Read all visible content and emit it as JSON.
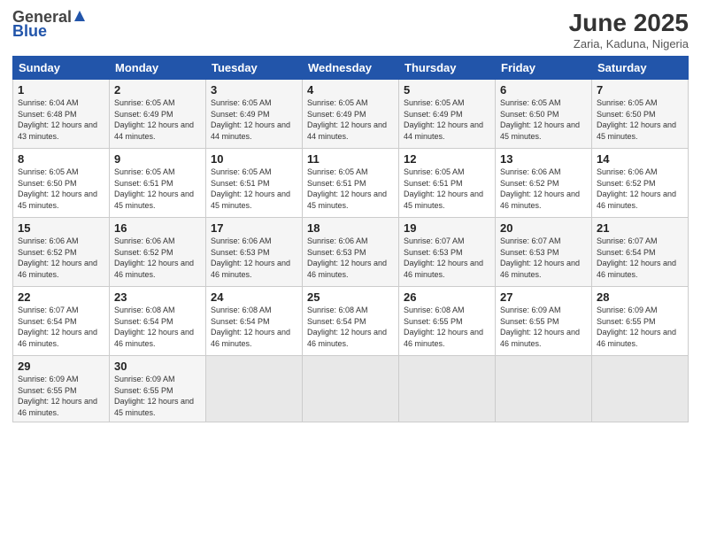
{
  "header": {
    "logo_general": "General",
    "logo_blue": "Blue",
    "title": "June 2025",
    "subtitle": "Zaria, Kaduna, Nigeria"
  },
  "weekdays": [
    "Sunday",
    "Monday",
    "Tuesday",
    "Wednesday",
    "Thursday",
    "Friday",
    "Saturday"
  ],
  "weeks": [
    [
      {
        "day": "1",
        "sunrise": "6:04 AM",
        "sunset": "6:48 PM",
        "daylight": "12 hours and 43 minutes."
      },
      {
        "day": "2",
        "sunrise": "6:05 AM",
        "sunset": "6:49 PM",
        "daylight": "12 hours and 44 minutes."
      },
      {
        "day": "3",
        "sunrise": "6:05 AM",
        "sunset": "6:49 PM",
        "daylight": "12 hours and 44 minutes."
      },
      {
        "day": "4",
        "sunrise": "6:05 AM",
        "sunset": "6:49 PM",
        "daylight": "12 hours and 44 minutes."
      },
      {
        "day": "5",
        "sunrise": "6:05 AM",
        "sunset": "6:49 PM",
        "daylight": "12 hours and 44 minutes."
      },
      {
        "day": "6",
        "sunrise": "6:05 AM",
        "sunset": "6:50 PM",
        "daylight": "12 hours and 45 minutes."
      },
      {
        "day": "7",
        "sunrise": "6:05 AM",
        "sunset": "6:50 PM",
        "daylight": "12 hours and 45 minutes."
      }
    ],
    [
      {
        "day": "8",
        "sunrise": "6:05 AM",
        "sunset": "6:50 PM",
        "daylight": "12 hours and 45 minutes."
      },
      {
        "day": "9",
        "sunrise": "6:05 AM",
        "sunset": "6:51 PM",
        "daylight": "12 hours and 45 minutes."
      },
      {
        "day": "10",
        "sunrise": "6:05 AM",
        "sunset": "6:51 PM",
        "daylight": "12 hours and 45 minutes."
      },
      {
        "day": "11",
        "sunrise": "6:05 AM",
        "sunset": "6:51 PM",
        "daylight": "12 hours and 45 minutes."
      },
      {
        "day": "12",
        "sunrise": "6:05 AM",
        "sunset": "6:51 PM",
        "daylight": "12 hours and 45 minutes."
      },
      {
        "day": "13",
        "sunrise": "6:06 AM",
        "sunset": "6:52 PM",
        "daylight": "12 hours and 46 minutes."
      },
      {
        "day": "14",
        "sunrise": "6:06 AM",
        "sunset": "6:52 PM",
        "daylight": "12 hours and 46 minutes."
      }
    ],
    [
      {
        "day": "15",
        "sunrise": "6:06 AM",
        "sunset": "6:52 PM",
        "daylight": "12 hours and 46 minutes."
      },
      {
        "day": "16",
        "sunrise": "6:06 AM",
        "sunset": "6:52 PM",
        "daylight": "12 hours and 46 minutes."
      },
      {
        "day": "17",
        "sunrise": "6:06 AM",
        "sunset": "6:53 PM",
        "daylight": "12 hours and 46 minutes."
      },
      {
        "day": "18",
        "sunrise": "6:06 AM",
        "sunset": "6:53 PM",
        "daylight": "12 hours and 46 minutes."
      },
      {
        "day": "19",
        "sunrise": "6:07 AM",
        "sunset": "6:53 PM",
        "daylight": "12 hours and 46 minutes."
      },
      {
        "day": "20",
        "sunrise": "6:07 AM",
        "sunset": "6:53 PM",
        "daylight": "12 hours and 46 minutes."
      },
      {
        "day": "21",
        "sunrise": "6:07 AM",
        "sunset": "6:54 PM",
        "daylight": "12 hours and 46 minutes."
      }
    ],
    [
      {
        "day": "22",
        "sunrise": "6:07 AM",
        "sunset": "6:54 PM",
        "daylight": "12 hours and 46 minutes."
      },
      {
        "day": "23",
        "sunrise": "6:08 AM",
        "sunset": "6:54 PM",
        "daylight": "12 hours and 46 minutes."
      },
      {
        "day": "24",
        "sunrise": "6:08 AM",
        "sunset": "6:54 PM",
        "daylight": "12 hours and 46 minutes."
      },
      {
        "day": "25",
        "sunrise": "6:08 AM",
        "sunset": "6:54 PM",
        "daylight": "12 hours and 46 minutes."
      },
      {
        "day": "26",
        "sunrise": "6:08 AM",
        "sunset": "6:55 PM",
        "daylight": "12 hours and 46 minutes."
      },
      {
        "day": "27",
        "sunrise": "6:09 AM",
        "sunset": "6:55 PM",
        "daylight": "12 hours and 46 minutes."
      },
      {
        "day": "28",
        "sunrise": "6:09 AM",
        "sunset": "6:55 PM",
        "daylight": "12 hours and 46 minutes."
      }
    ],
    [
      {
        "day": "29",
        "sunrise": "6:09 AM",
        "sunset": "6:55 PM",
        "daylight": "12 hours and 46 minutes."
      },
      {
        "day": "30",
        "sunrise": "6:09 AM",
        "sunset": "6:55 PM",
        "daylight": "12 hours and 45 minutes."
      },
      null,
      null,
      null,
      null,
      null
    ]
  ]
}
